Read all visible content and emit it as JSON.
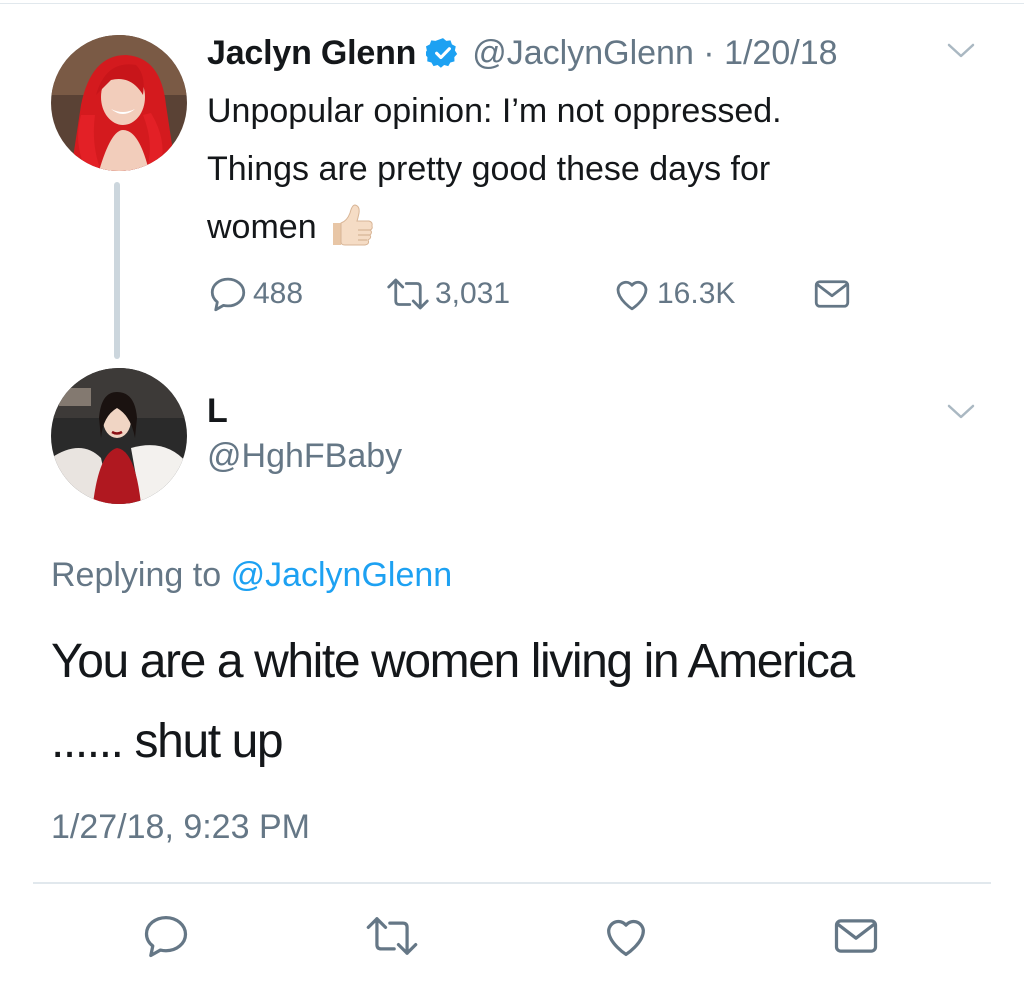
{
  "parent_tweet": {
    "author": {
      "display_name": "Jaclyn Glenn",
      "verified_icon": "verified-badge-icon",
      "handle_and_date": "@JaclynGlenn · 1/20/18",
      "avatar": "avatar-photo-red-hair"
    },
    "text_line_1": "Unpopular opinion: I’m not oppressed.",
    "text_line_2": "Things are pretty good these days for",
    "text_line_3": "women",
    "emoji": "thumbs-up-emoji",
    "stats": {
      "replies": "488",
      "retweets": "3,031",
      "likes": "16.3K"
    }
  },
  "reply_tweet": {
    "author": {
      "display_name": "L",
      "handle": "@HghFBaby",
      "avatar": "avatar-photo-red-dress"
    },
    "replying_prefix": "Replying to",
    "replying_mention": "@JaclynGlenn",
    "text_line_1": "You are a white women living in America",
    "text_line_2": "...... shut up",
    "timestamp": "1/27/18, 9:23 PM"
  },
  "colors": {
    "text": "#14171a",
    "secondary": "#657786",
    "link": "#1da1f2",
    "verified": "#1da1f2",
    "divider": "#e1e8ed",
    "thread_line": "#ccd6dd"
  }
}
